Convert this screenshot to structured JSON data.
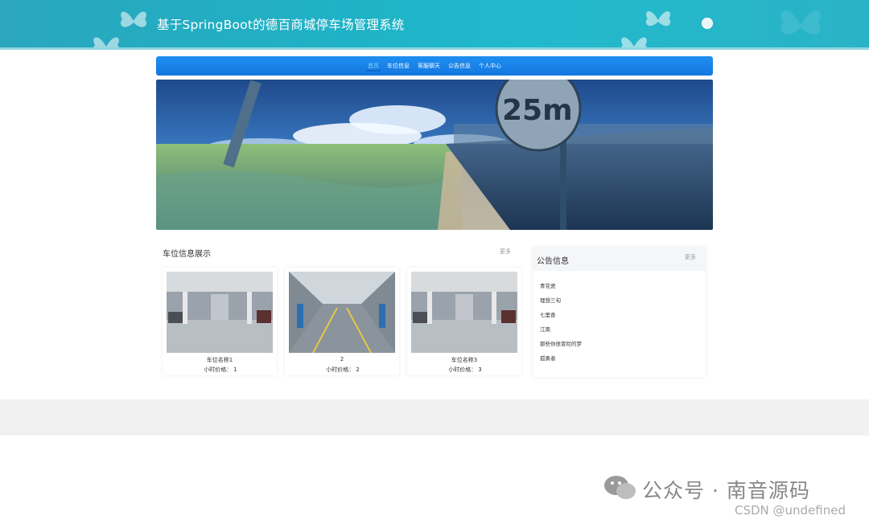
{
  "header": {
    "title": "基于SpringBoot的德百商城停车场管理系统",
    "colors": {
      "header_start": "#2aa6bd",
      "header_end": "#22b9cc"
    }
  },
  "nav": {
    "items": [
      {
        "label": "首页",
        "active": true
      },
      {
        "label": "车位信息",
        "active": false
      },
      {
        "label": "客服聊天",
        "active": false
      },
      {
        "label": "公告信息",
        "active": false
      },
      {
        "label": "个人中心",
        "active": false
      }
    ],
    "color": "#1a83e8"
  },
  "banner": {
    "sign_text": "25m"
  },
  "parking": {
    "title": "车位信息展示",
    "more": "更多",
    "price_label": "小时价格：",
    "items": [
      {
        "name": "车位名称1",
        "price": "1"
      },
      {
        "name": "2",
        "price": "2"
      },
      {
        "name": "车位名称3",
        "price": "3"
      }
    ]
  },
  "notice": {
    "title": "公告信息",
    "more": "更多",
    "items": [
      "青花瓷",
      "理想三旬",
      "七里香",
      "江南",
      "那些你很冒险的梦",
      "孤勇者"
    ]
  },
  "watermark": {
    "main": "公众号 · 南音源码",
    "sub": "CSDN @undefined"
  }
}
